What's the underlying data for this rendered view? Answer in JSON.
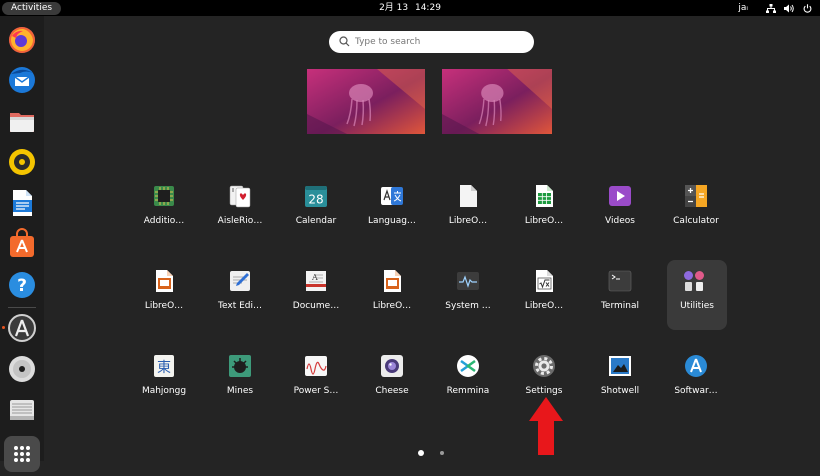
{
  "topbar": {
    "activities": "Activities",
    "date": "2月 13",
    "time": "14:29",
    "input_method": "jaᵢ",
    "tray_icons": [
      "network-icon",
      "volume-icon",
      "power-icon"
    ]
  },
  "search": {
    "placeholder": "Type to search"
  },
  "dock": {
    "items": [
      {
        "name": "firefox",
        "icon": "firefox-icon"
      },
      {
        "name": "thunderbird",
        "icon": "thunderbird-icon"
      },
      {
        "name": "files",
        "icon": "files-icon"
      },
      {
        "name": "rhythmbox",
        "icon": "rhythmbox-icon"
      },
      {
        "name": "libreoffice-writer",
        "icon": "writer-icon"
      },
      {
        "name": "ubuntu-software",
        "icon": "software-store-icon"
      },
      {
        "name": "help",
        "icon": "help-icon"
      },
      {
        "name": "software-updater",
        "icon": "updater-icon"
      },
      {
        "name": "dvd",
        "icon": "disc-icon"
      },
      {
        "name": "disk",
        "icon": "disk-icon"
      }
    ],
    "show_apps": "grid-icon"
  },
  "apps": [
    {
      "label": "Additio…",
      "icon": "chip-icon"
    },
    {
      "label": "AisleRio…",
      "icon": "cards-icon"
    },
    {
      "label": "Calendar",
      "icon": "calendar-icon",
      "day": "28"
    },
    {
      "label": "Languag…",
      "icon": "language-icon"
    },
    {
      "label": "LibreO…",
      "icon": "libreoffice-icon"
    },
    {
      "label": "LibreO…",
      "icon": "calc-icon"
    },
    {
      "label": "Videos",
      "icon": "videos-icon"
    },
    {
      "label": "Calculator",
      "icon": "calculator-icon"
    },
    {
      "label": "LibreO…",
      "icon": "impress-icon"
    },
    {
      "label": "Text Edi…",
      "icon": "text-editor-icon"
    },
    {
      "label": "Docume…",
      "icon": "document-viewer-icon"
    },
    {
      "label": "LibreO…",
      "icon": "impress-icon"
    },
    {
      "label": "System …",
      "icon": "system-monitor-icon"
    },
    {
      "label": "LibreO…",
      "icon": "math-icon"
    },
    {
      "label": "Terminal",
      "icon": "terminal-icon"
    },
    {
      "label": "Utilities",
      "icon": "utilities-folder-icon"
    },
    {
      "label": "Mahjongg",
      "icon": "mahjongg-icon",
      "glyph": "東"
    },
    {
      "label": "Mines",
      "icon": "mines-icon"
    },
    {
      "label": "Power S…",
      "icon": "power-stats-icon"
    },
    {
      "label": "Cheese",
      "icon": "cheese-icon"
    },
    {
      "label": "Remmina",
      "icon": "remmina-icon"
    },
    {
      "label": "Settings",
      "icon": "settings-icon"
    },
    {
      "label": "Shotwell",
      "icon": "shotwell-icon"
    },
    {
      "label": "Softwar…",
      "icon": "software-icon"
    }
  ],
  "workspaces": 2,
  "pages": {
    "count": 2,
    "current": 1
  },
  "annotation": {
    "color": "#e8171b",
    "points_to": "Settings"
  },
  "colors": {
    "accent": "#e95420",
    "background": "#242424",
    "topbar": "#000000",
    "dock": "#1d1d1d"
  }
}
